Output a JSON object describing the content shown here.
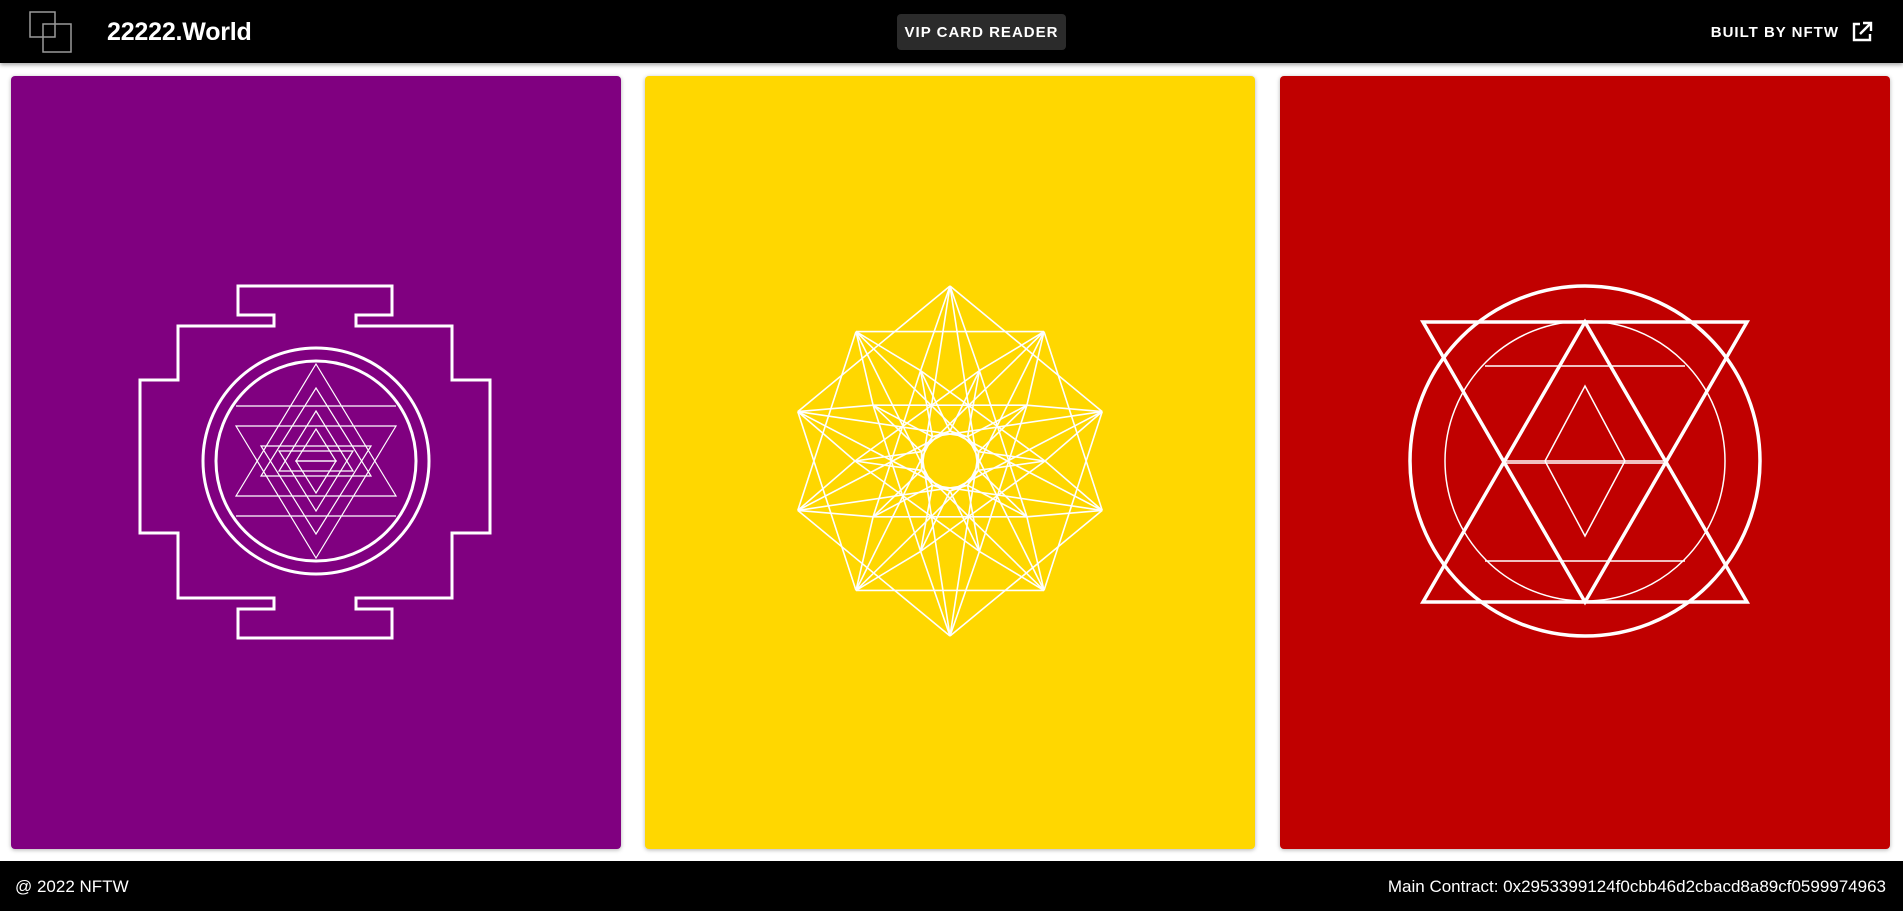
{
  "header": {
    "site_title": "22222.World",
    "vip_button_label": "VIP CARD READER",
    "built_by_label": "BUILT BY NFTW",
    "logo_icon": "overlapping-squares-logo",
    "external_link_icon": "external-link-icon"
  },
  "cards": [
    {
      "name": "purple-card",
      "color": "#800080",
      "symbol": "sri-yantra"
    },
    {
      "name": "yellow-card",
      "color": "#FFD700",
      "symbol": "geometric-star"
    },
    {
      "name": "red-card",
      "color": "#C00000",
      "symbol": "star-of-david-circle"
    }
  ],
  "footer": {
    "copyright": "@ 2022 NFTW",
    "main_contract": "Main Contract: 0x2953399124f0cbb46d2cbacd8a89cf0599974963"
  }
}
